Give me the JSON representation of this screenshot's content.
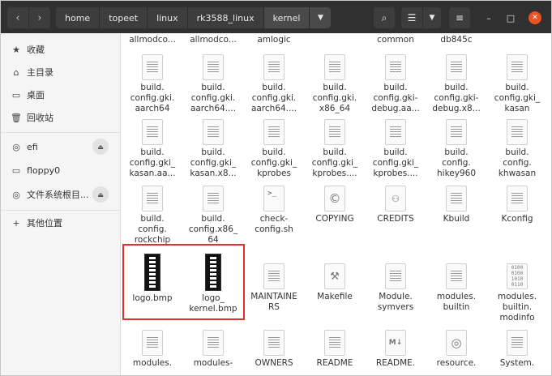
{
  "headerbar": {
    "back_icon": "chevron-left-icon",
    "forward_icon": "chevron-right-icon",
    "breadcrumbs": [
      "home",
      "topeet",
      "linux",
      "rk3588_linux",
      "kernel"
    ],
    "search_icon": "search-icon",
    "view_icon": "list-view-icon",
    "menu_icon": "hamburger-icon",
    "close_color": "#e95420"
  },
  "sidebar": {
    "items": [
      {
        "icon": "★",
        "label": "收藏"
      },
      {
        "icon": "⌂",
        "label": "主目录"
      },
      {
        "icon": "▭",
        "label": "桌面"
      },
      {
        "icon": "🗑",
        "label": "回收站"
      },
      {
        "icon": "◎",
        "label": "efi"
      },
      {
        "icon": "▭",
        "label": "floppy0"
      },
      {
        "icon": "◎",
        "label": "文件系统根目..."
      },
      {
        "icon": "+",
        "label": "其他位置"
      }
    ]
  },
  "files": {
    "row0": [
      "allmodco...",
      "allmodco...",
      "amlogic",
      "common",
      "db845c"
    ],
    "row1": [
      "build.\nconfig.gki.\naarch64",
      "build.\nconfig.gki.\naarch64....",
      "build.\nconfig.gki.\naarch64....",
      "build.\nconfig.gki.\nx86_64",
      "build.\nconfig.gki-\ndebug.aa...",
      "build.\nconfig.gki-\ndebug.x8...",
      "build.\nconfig.gki_\nkasan"
    ],
    "row2": [
      "build.\nconfig.gki_\nkasan.aa...",
      "build.\nconfig.gki_\nkasan.x8...",
      "build.\nconfig.gki_\nkprobes",
      "build.\nconfig.gki_\nkprobes....",
      "build.\nconfig.gki_\nkprobes....",
      "build.\nconfig.\nhikey960",
      "build.\nconfig.\nkhwasan"
    ],
    "row3": [
      "build.\nconfig.\nrockchip",
      "build.\nconfig.x86_\n64",
      "check-\nconfig.sh",
      "COPYING",
      "CREDITS",
      "Kbuild",
      "Kconfig"
    ],
    "row4": [
      "logo.bmp",
      "logo_\nkernel.bmp",
      "MAINTAINE\nRS",
      "Makefile",
      "Module.\nsymvers",
      "modules.\nbuiltin",
      "modules.\nbuiltin.\nmodinfo"
    ],
    "row5": [
      "modules.",
      "modules-",
      "OWNERS",
      "README",
      "README.",
      "resource.",
      "System."
    ]
  }
}
